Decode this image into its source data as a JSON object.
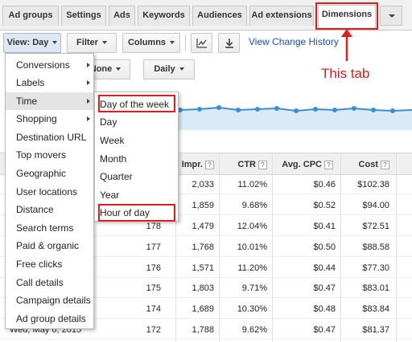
{
  "tabs": [
    "Ad groups",
    "Settings",
    "Ads",
    "Keywords",
    "Audiences",
    "Ad extensions",
    "Dimensions"
  ],
  "toolbar": {
    "view_label": "View: Day",
    "filter_label": "Filter",
    "columns_label": "Columns",
    "change_history_link": "View Change History",
    "segment_label": "None",
    "period_label": "Daily"
  },
  "annotation": {
    "text": "This tab"
  },
  "view_menu": {
    "items": [
      "Conversions",
      "Labels",
      "Time",
      "Shopping",
      "Destination URL",
      "Top movers",
      "Geographic",
      "User locations",
      "Distance",
      "Search terms",
      "Paid & organic",
      "Free clicks",
      "Call details",
      "Campaign details",
      "Ad group details"
    ]
  },
  "time_submenu": {
    "items": [
      "Day of the week",
      "Day",
      "Week",
      "Month",
      "Quarter",
      "Year",
      "Hour of day"
    ]
  },
  "table": {
    "headers": {
      "impr": "Impr.",
      "ctr": "CTR",
      "avg_cpc": "Avg. CPC",
      "cost": "Cost",
      "help": "?"
    },
    "rows": [
      {
        "date": "",
        "clicks": "",
        "impr": "2,033",
        "ctr": "11.02%",
        "cpc": "$0.46",
        "cost": "$102.38"
      },
      {
        "date": "",
        "clicks": "",
        "impr": "1,859",
        "ctr": "9.68%",
        "cpc": "$0.52",
        "cost": "$94.00"
      },
      {
        "date": "",
        "clicks": "178",
        "impr": "1,479",
        "ctr": "12.04%",
        "cpc": "$0.41",
        "cost": "$72.51"
      },
      {
        "date": "",
        "clicks": "177",
        "impr": "1,768",
        "ctr": "10.01%",
        "cpc": "$0.50",
        "cost": "$88.58"
      },
      {
        "date": "",
        "clicks": "176",
        "impr": "1,571",
        "ctr": "11.20%",
        "cpc": "$0.44",
        "cost": "$77.30"
      },
      {
        "date": "",
        "clicks": "175",
        "impr": "1,803",
        "ctr": "9.71%",
        "cpc": "$0.47",
        "cost": "$83.01"
      },
      {
        "date": "",
        "clicks": "174",
        "impr": "1,689",
        "ctr": "10.30%",
        "cpc": "$0.48",
        "cost": "$83.84"
      },
      {
        "date": "Wed, May 6, 2015",
        "clicks": "172",
        "impr": "1,788",
        "ctr": "9.62%",
        "cpc": "$0.47",
        "cost": "$81.37"
      }
    ]
  },
  "colors": {
    "accent_red": "#e21b1b",
    "link_blue": "#1a4fbf",
    "chart_line": "#3a8fd4"
  }
}
